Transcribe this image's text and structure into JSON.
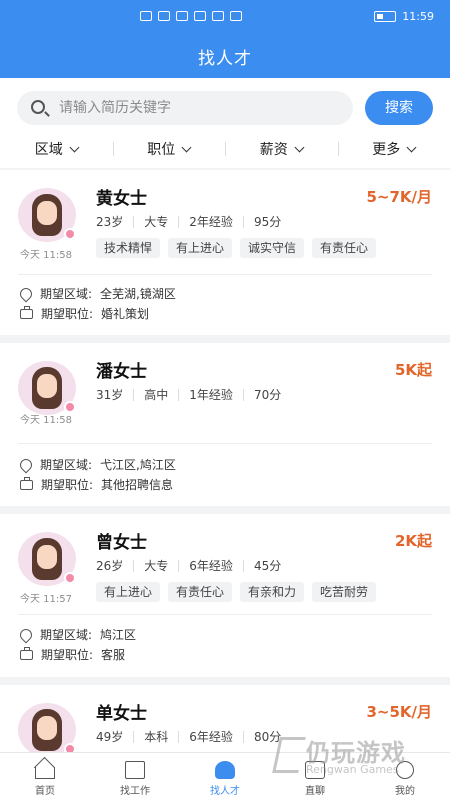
{
  "status_bar": {
    "time": "11:59"
  },
  "header": {
    "title": "找人才"
  },
  "search": {
    "placeholder": "请输入简历关键字",
    "button": "搜索"
  },
  "filters": [
    "区域",
    "职位",
    "薪资",
    "更多"
  ],
  "candidates": [
    {
      "name": "黄女士",
      "salary": "5~7K/月",
      "time": "今天 11:58",
      "age": "23岁",
      "education": "大专",
      "experience": "2年经验",
      "score": "95分",
      "tags": [
        "技术精悍",
        "有上进心",
        "诚实守信",
        "有责任心"
      ],
      "area_label": "期望区域:",
      "area": "全芜湖,镜湖区",
      "position_label": "期望职位:",
      "position": "婚礼策划"
    },
    {
      "name": "潘女士",
      "salary": "5K起",
      "time": "今天 11:58",
      "age": "31岁",
      "education": "高中",
      "experience": "1年经验",
      "score": "70分",
      "tags": [],
      "area_label": "期望区域:",
      "area": "弋江区,鸠江区",
      "position_label": "期望职位:",
      "position": "其他招聘信息"
    },
    {
      "name": "曾女士",
      "salary": "2K起",
      "time": "今天 11:57",
      "age": "26岁",
      "education": "大专",
      "experience": "6年经验",
      "score": "45分",
      "tags": [
        "有上进心",
        "有责任心",
        "有亲和力",
        "吃苦耐劳"
      ],
      "area_label": "期望区域:",
      "area": "鸠江区",
      "position_label": "期望职位:",
      "position": "客服"
    },
    {
      "name": "单女士",
      "salary": "3~5K/月",
      "time": "",
      "age": "49岁",
      "education": "本科",
      "experience": "6年经验",
      "score": "80分",
      "tags": [],
      "area_label": "",
      "area": "",
      "position_label": "",
      "position": ""
    }
  ],
  "nav": [
    {
      "label": "首页",
      "icon": "home-icon"
    },
    {
      "label": "找工作",
      "icon": "briefcase-icon"
    },
    {
      "label": "找人才",
      "icon": "talent-icon",
      "active": true
    },
    {
      "label": "直聊",
      "icon": "chat-icon"
    },
    {
      "label": "我的",
      "icon": "profile-icon"
    }
  ],
  "watermark": {
    "title": "仍玩游戏",
    "subtitle": "Rengwan Games"
  },
  "colors": {
    "primary": "#3b8df0",
    "salary": "#e2652b",
    "background": "#f2f3f5"
  }
}
